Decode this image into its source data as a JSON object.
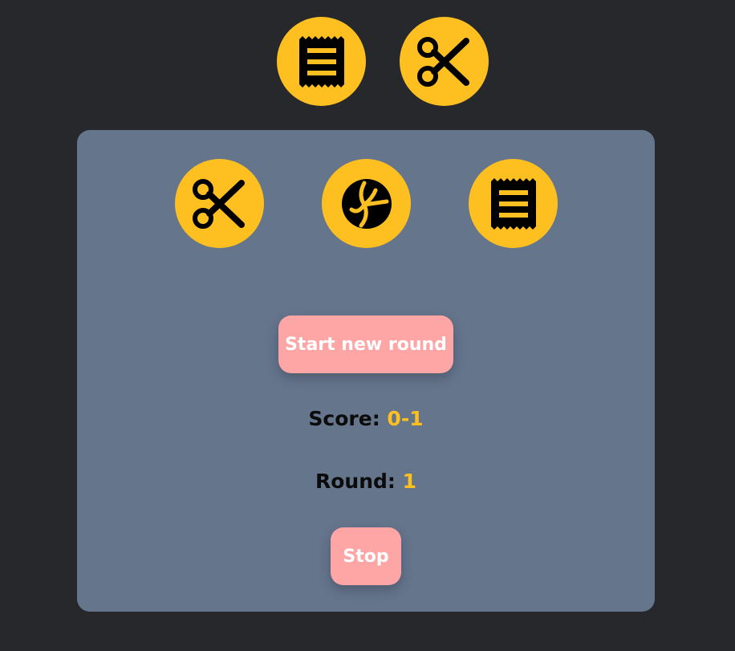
{
  "colors": {
    "background": "#27282c",
    "panel": "#65758c",
    "accent": "#fec020",
    "button": "#fea6a6",
    "button_text": "#ffffff"
  },
  "choices": {
    "player": "paper-icon",
    "computer": "scissors-icon"
  },
  "options": [
    "scissors-icon",
    "rock-icon",
    "paper-icon"
  ],
  "buttons": {
    "start": "Start new round",
    "stop": "Stop"
  },
  "score": {
    "label": "Score:",
    "value": "0-1"
  },
  "round": {
    "label": "Round:",
    "value": "1"
  }
}
